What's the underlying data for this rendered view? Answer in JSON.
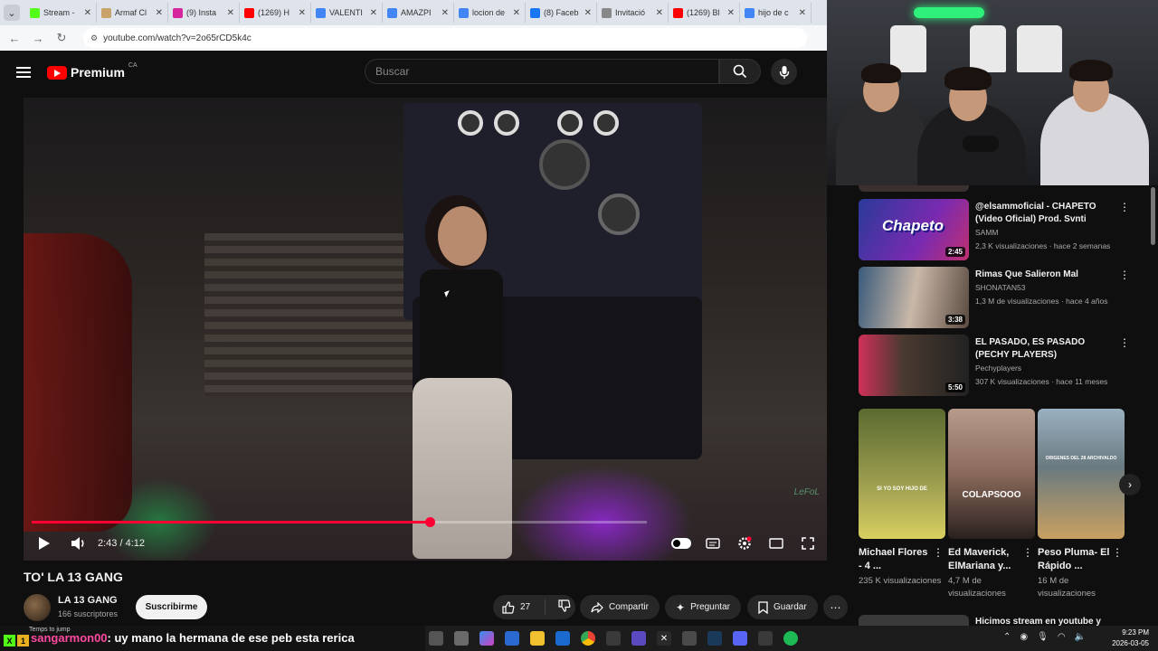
{
  "browser": {
    "tabs": [
      {
        "label": "Stream -",
        "color": "#53fc18"
      },
      {
        "label": "Armaf Cl",
        "color": "#c9a46a"
      },
      {
        "label": "(9) Insta",
        "color": "#d6249f"
      },
      {
        "label": "(1269) H",
        "color": "#ff0000"
      },
      {
        "label": "VALENTI",
        "color": "#4285f4"
      },
      {
        "label": "AMAZPI",
        "color": "#4285f4"
      },
      {
        "label": "locion de",
        "color": "#4285f4"
      },
      {
        "label": "(8) Faceb",
        "color": "#1877f2"
      },
      {
        "label": "Invitació",
        "color": "#888888"
      },
      {
        "label": "(1269) Bl",
        "color": "#ff0000"
      },
      {
        "label": "hijo de c",
        "color": "#4285f4"
      }
    ],
    "url": "youtube.com/watch?v=2o65rCD5k4c"
  },
  "header": {
    "logo_text": "Premium",
    "country": "CA",
    "search_placeholder": "Buscar"
  },
  "player": {
    "time": "2:43 / 4:12",
    "progress_fraction": 0.647,
    "watermark": "LeFoL"
  },
  "video": {
    "title": "TO' LA 13 GANG",
    "channel": "LA 13 GANG",
    "subscribers": "166 suscriptores",
    "subscribe_label": "Suscribirme",
    "likes": "27",
    "share_label": "Compartir",
    "ask_label": "Preguntar",
    "save_label": "Guardar"
  },
  "recommendations": [
    {
      "title": "@elsammoficial - CHAPETO (Video Oficial) Prod. Svnti",
      "channel": "SAMM",
      "meta": "2,3 K visualizaciones · hace 2 semanas",
      "duration": "2:45",
      "thumb_text": "Chapeto"
    },
    {
      "title": "Rimas Que Salieron Mal",
      "channel": "SHONATAN53",
      "meta": "1,3 M de visualizaciones · hace 4 años",
      "duration": "3:38",
      "thumb_text": ""
    },
    {
      "title": "EL PASADO, ES PASADO (PECHY PLAYERS)",
      "channel": "Pechyplayers",
      "meta": "307 K visualizaciones · hace 11 meses",
      "duration": "5:50",
      "thumb_text": ""
    }
  ],
  "shorts": [
    {
      "title": "Michael Flores - 4 ...",
      "views": "235 K visualizaciones",
      "thumb_text": "SI YO SOY HIJO DE"
    },
    {
      "title": "Ed Maverick, ElMariana y...",
      "views": "4,7 M de visualizaciones",
      "thumb_text": "COLAPSOOO"
    },
    {
      "title": "Peso Pluma- El Rápido ...",
      "views": "16 M de visualizaciones",
      "thumb_text": "ORIGENES DEL 28 ARCHIVALDO"
    }
  ],
  "partial_rec_title": "Hicimos stream en youtube y",
  "chat": {
    "hint": "Temps to jump",
    "user": "sangarmon00",
    "message": ": uy mano la hermana de ese peb esta rerica"
  },
  "taskbar": {
    "time": "9:23 PM",
    "date": "2026-03-05"
  }
}
